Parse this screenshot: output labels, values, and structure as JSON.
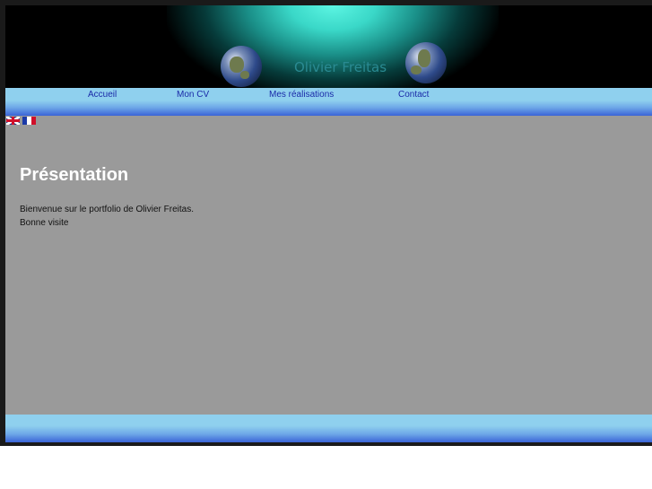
{
  "header": {
    "site_title": "Olivier Freitas"
  },
  "nav": {
    "items": [
      {
        "label": "Accueil"
      },
      {
        "label": "Mon CV"
      },
      {
        "label": "Mes réalisations"
      },
      {
        "label": "Contact"
      }
    ]
  },
  "languages": {
    "flags": [
      "english-flag-icon",
      "french-flag-icon"
    ]
  },
  "main": {
    "heading": "Présentation",
    "lines": [
      "Bienvenue sur le portfolio de Olivier Freitas.",
      "Bonne visite"
    ]
  },
  "colors": {
    "nav_link": "#1a2aa8",
    "content_bg": "#9a9a9a",
    "title": "#2a8a92"
  }
}
